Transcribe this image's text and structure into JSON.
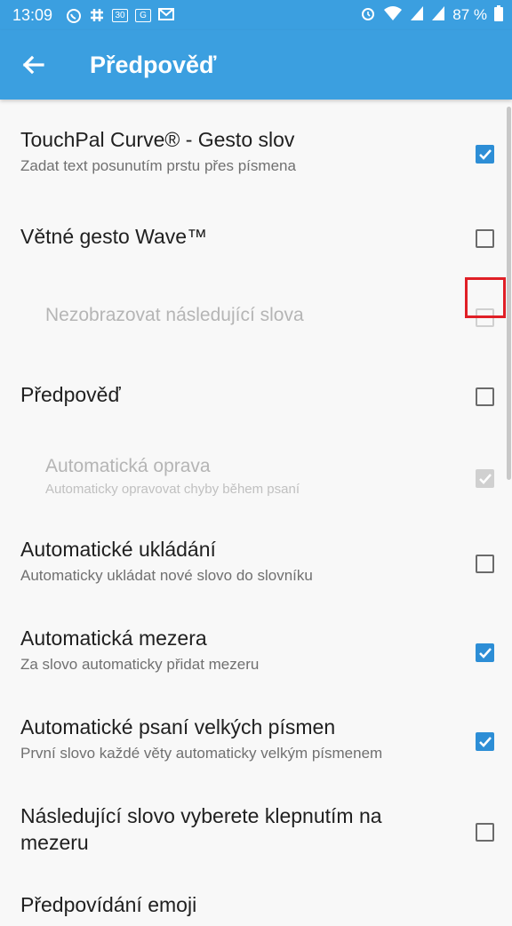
{
  "status_bar": {
    "time": "13:09",
    "left_icons": [
      "whatsapp-icon",
      "slack-icon",
      "calendar-icon",
      "gmail-badge-icon",
      "mail-icon"
    ],
    "calendar_day": "30",
    "right_icons": [
      "alarm-icon",
      "wifi-icon",
      "signal-icon",
      "signal-icon"
    ],
    "battery": "87 %"
  },
  "app_bar": {
    "title": "Předpověď",
    "back_icon": "arrow-left-icon"
  },
  "settings": [
    {
      "title": "TouchPal Curve® - Gesto slov",
      "subtitle": "Zadat text posunutím prstu přes písmena",
      "checked": true,
      "enabled": true
    },
    {
      "title": "Větné gesto Wave™",
      "subtitle": "",
      "checked": false,
      "enabled": true
    },
    {
      "title": "Nezobrazovat následující slova",
      "subtitle": "",
      "checked": false,
      "enabled": false
    },
    {
      "title": "Předpověď",
      "subtitle": "",
      "checked": false,
      "enabled": true
    },
    {
      "title": "Automatická oprava",
      "subtitle": "Automaticky opravovat chyby během psaní",
      "checked": true,
      "enabled": false
    },
    {
      "title": "Automatické ukládání",
      "subtitle": "Automaticky ukládat nové slovo do slovníku",
      "checked": false,
      "enabled": true
    },
    {
      "title": "Automatická mezera",
      "subtitle": "Za slovo automaticky přidat mezeru",
      "checked": true,
      "enabled": true
    },
    {
      "title": "Automatické psaní velkých písmen",
      "subtitle": "První slovo každé věty automaticky velkým písmenem",
      "checked": true,
      "enabled": true
    },
    {
      "title_line1": "Následující slovo vyberete klepnutím na",
      "title_line2": "mezeru",
      "checked": false,
      "enabled": true
    },
    {
      "title": "Předpovídání emoji",
      "subtitle": "",
      "enabled": true
    }
  ],
  "colors": {
    "accent": "#3b9fe0",
    "checkbox": "#2d8ed6",
    "highlight": "#e01f26"
  }
}
